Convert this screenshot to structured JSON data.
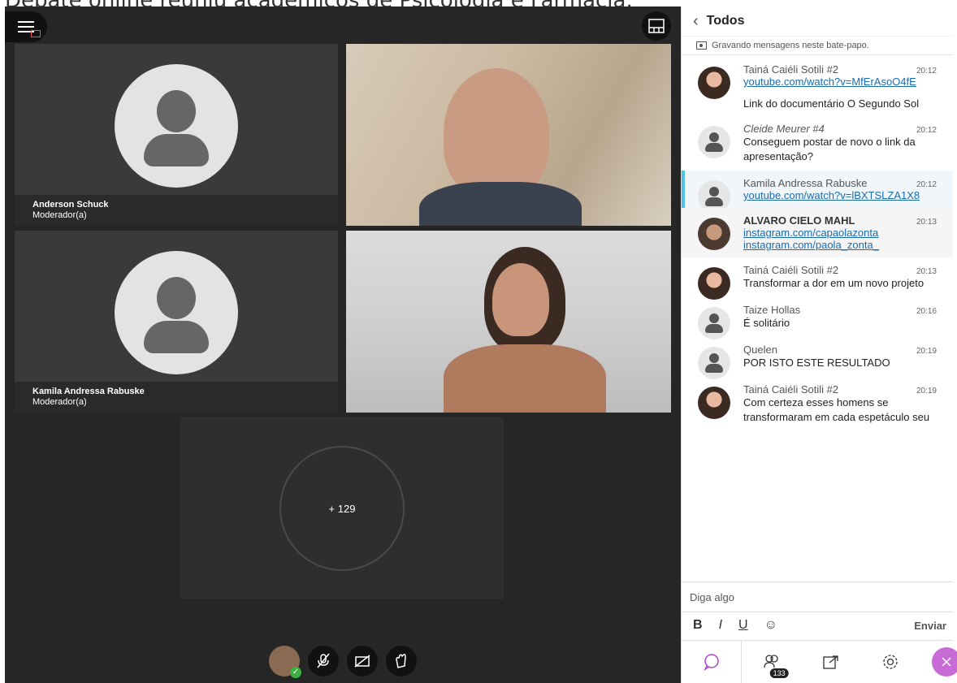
{
  "caption": "Debate online reuniu acadêmicos de Psicologia e Farmácia.",
  "participants": [
    {
      "name": "Anderson Schuck",
      "role": "Moderador(a)"
    },
    {
      "name": "Kamila Andressa Rabuske",
      "role": "Moderador(a)"
    }
  ],
  "overflow_count": "+ 129",
  "chat": {
    "header": "Todos",
    "recording_note": "Gravando mensagens neste bate-papo.",
    "messages": [
      {
        "author": "Tainá Caiéli Sotili #2",
        "time": "20:12",
        "link": "youtube.com/watch?v=MfErAsoO4fE",
        "extra": "Link do documentário O Segundo Sol"
      },
      {
        "author": "Cleide Meurer #4",
        "time": "20:12",
        "text": "Conseguem postar de novo o link da apresentação?"
      },
      {
        "author": "Kamila Andressa Rabuske",
        "time": "20:12",
        "link": "youtube.com/watch?v=lBXTSLZA1X8"
      },
      {
        "author": "ALVARO CIELO MAHL",
        "time": "20:13",
        "link1": "instagram.com/capaolazonta",
        "link2": "instagram.com/paola_zonta_"
      },
      {
        "author": "Tainá Caiéli Sotili #2",
        "time": "20:13",
        "text": "Transformar a dor em um novo projeto"
      },
      {
        "author": "Taize Hollas",
        "time": "20:16",
        "text": "É solitário"
      },
      {
        "author": "Quelen",
        "time": "20:19",
        "text": "POR ISTO ESTE RESULTADO"
      },
      {
        "author": "Tainá Caiéli Sotili #2",
        "time": "20:19",
        "text": "Com certeza esses homens se transformaram em cada espetáculo seu"
      }
    ],
    "input_placeholder": "Diga algo",
    "format": {
      "bold": "B",
      "italic": "I",
      "underline": "U"
    },
    "send_label": "Enviar",
    "attendee_count": "133"
  }
}
